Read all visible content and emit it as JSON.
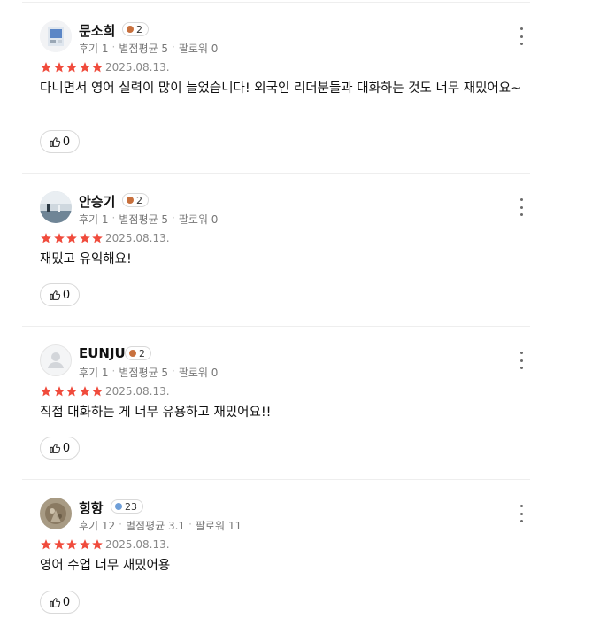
{
  "colors": {
    "star": "#f04b3c",
    "bronze": "#c8703d",
    "blue": "#6f9fd8"
  },
  "reviews": [
    {
      "name": "문소희",
      "badge": "2",
      "badge_color": "#c8703d",
      "reviews_label": "후기 1",
      "rating_label": "별점평균 5",
      "followers_label": "팔로워 0",
      "stars": 5,
      "date": "2025.08.13.",
      "text": "다니면서 영어 실력이 많이 늘었습니다! 외국인 리더분들과 대화하는 것도 너무 재밌어요~",
      "likes": "0"
    },
    {
      "name": "안승기",
      "badge": "2",
      "badge_color": "#c8703d",
      "reviews_label": "후기 1",
      "rating_label": "별점평균 5",
      "followers_label": "팔로워 0",
      "stars": 5,
      "date": "2025.08.13.",
      "text": "재밌고 유익해요!",
      "likes": "0"
    },
    {
      "name": "EUNJU",
      "badge": "2",
      "badge_color": "#c8703d",
      "reviews_label": "후기 1",
      "rating_label": "별점평균 5",
      "followers_label": "팔로워 0",
      "stars": 5,
      "date": "2025.08.13.",
      "text": "직접 대화하는 게 너무 유용하고 재밌어요!!",
      "likes": "0"
    },
    {
      "name": "힝항",
      "badge": "23",
      "badge_color": "#6f9fd8",
      "reviews_label": "후기 12",
      "rating_label": "별점평균 3.1",
      "followers_label": "팔로워 11",
      "stars": 5,
      "date": "2025.08.13.",
      "text": "영어 수업 너무 재밌어용",
      "likes": "0"
    }
  ]
}
